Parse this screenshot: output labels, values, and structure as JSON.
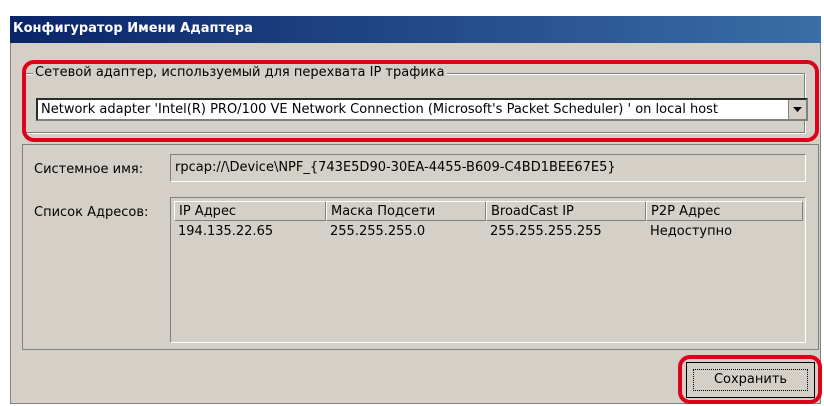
{
  "window": {
    "title": "Конфигуратор Имени Адаптера"
  },
  "adapter_group": {
    "legend": "Сетевой адаптер, используемый для перехвата IP трафика",
    "selected_adapter": "Network adapter 'Intel(R) PRO/100 VE Network Connection (Microsoft's Packet Scheduler) ' on local host"
  },
  "system_name": {
    "label": "Системное имя:",
    "value": "rpcap://\\Device\\NPF_{743E5D90-30EA-4455-B609-C4BD1BEE67E5}"
  },
  "address_list": {
    "label": "Список Адресов:",
    "columns": [
      "IP Адрес",
      "Маска Подсети",
      "BroadCast IP",
      "P2P Адрес"
    ],
    "rows": [
      [
        "194.135.22.65",
        "255.255.255.0",
        "255.255.255.255",
        "Недоступно"
      ]
    ]
  },
  "buttons": {
    "save": "Сохранить"
  },
  "colors": {
    "highlight": "#e0001a",
    "titlebar": "#0a246a",
    "dialog_bg": "#d4d0c8"
  }
}
